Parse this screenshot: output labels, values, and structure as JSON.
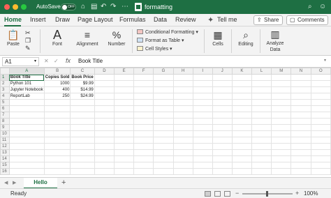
{
  "titlebar": {
    "autosave_label": "AutoSave",
    "autosave_state": "OFF",
    "doc_title": "formatting",
    "icons": [
      "home-icon",
      "save-icon",
      "print-icon",
      "undo-icon",
      "redo-icon",
      "more-icon",
      "search-icon",
      "person-icon"
    ]
  },
  "tabs": [
    "Home",
    "Insert",
    "Draw",
    "Page Layout",
    "Formulas",
    "Data",
    "Review",
    "View"
  ],
  "active_tab": "Home",
  "tell_me": "Tell me",
  "share_label": "Share",
  "comments_label": "Comments",
  "ribbon": {
    "paste": "Paste",
    "font": "Font",
    "alignment": "Alignment",
    "number": "Number",
    "conditional_formatting": "Conditional Formatting",
    "format_as_table": "Format as Table",
    "cell_styles": "Cell Styles",
    "cells": "Cells",
    "editing": "Editing",
    "analyze_data_1": "Analyze",
    "analyze_data_2": "Data"
  },
  "formula_bar": {
    "name_box": "A1",
    "fx": "fx",
    "content": "Book Title"
  },
  "grid": {
    "columns": [
      "A",
      "B",
      "C",
      "D",
      "E",
      "F",
      "G",
      "H",
      "I",
      "J",
      "K",
      "L",
      "M",
      "N",
      "O"
    ],
    "row_numbers": [
      "1",
      "2",
      "3",
      "4",
      "5",
      "6",
      "7",
      "8",
      "9",
      "10",
      "11",
      "12",
      "13",
      "14",
      "15",
      "16"
    ],
    "cells": [
      [
        "Book Title",
        "Copies Sold",
        "Book Price"
      ],
      [
        "Python 101",
        "1000",
        "$9.99"
      ],
      [
        "Jupyter Notebook",
        "400",
        "$14.99"
      ],
      [
        "ReportLab",
        "250",
        "$24.99"
      ]
    ]
  },
  "sheet_tab": "Hello",
  "status": "Ready",
  "zoom": "100%",
  "accent_color": "#1e6f43"
}
